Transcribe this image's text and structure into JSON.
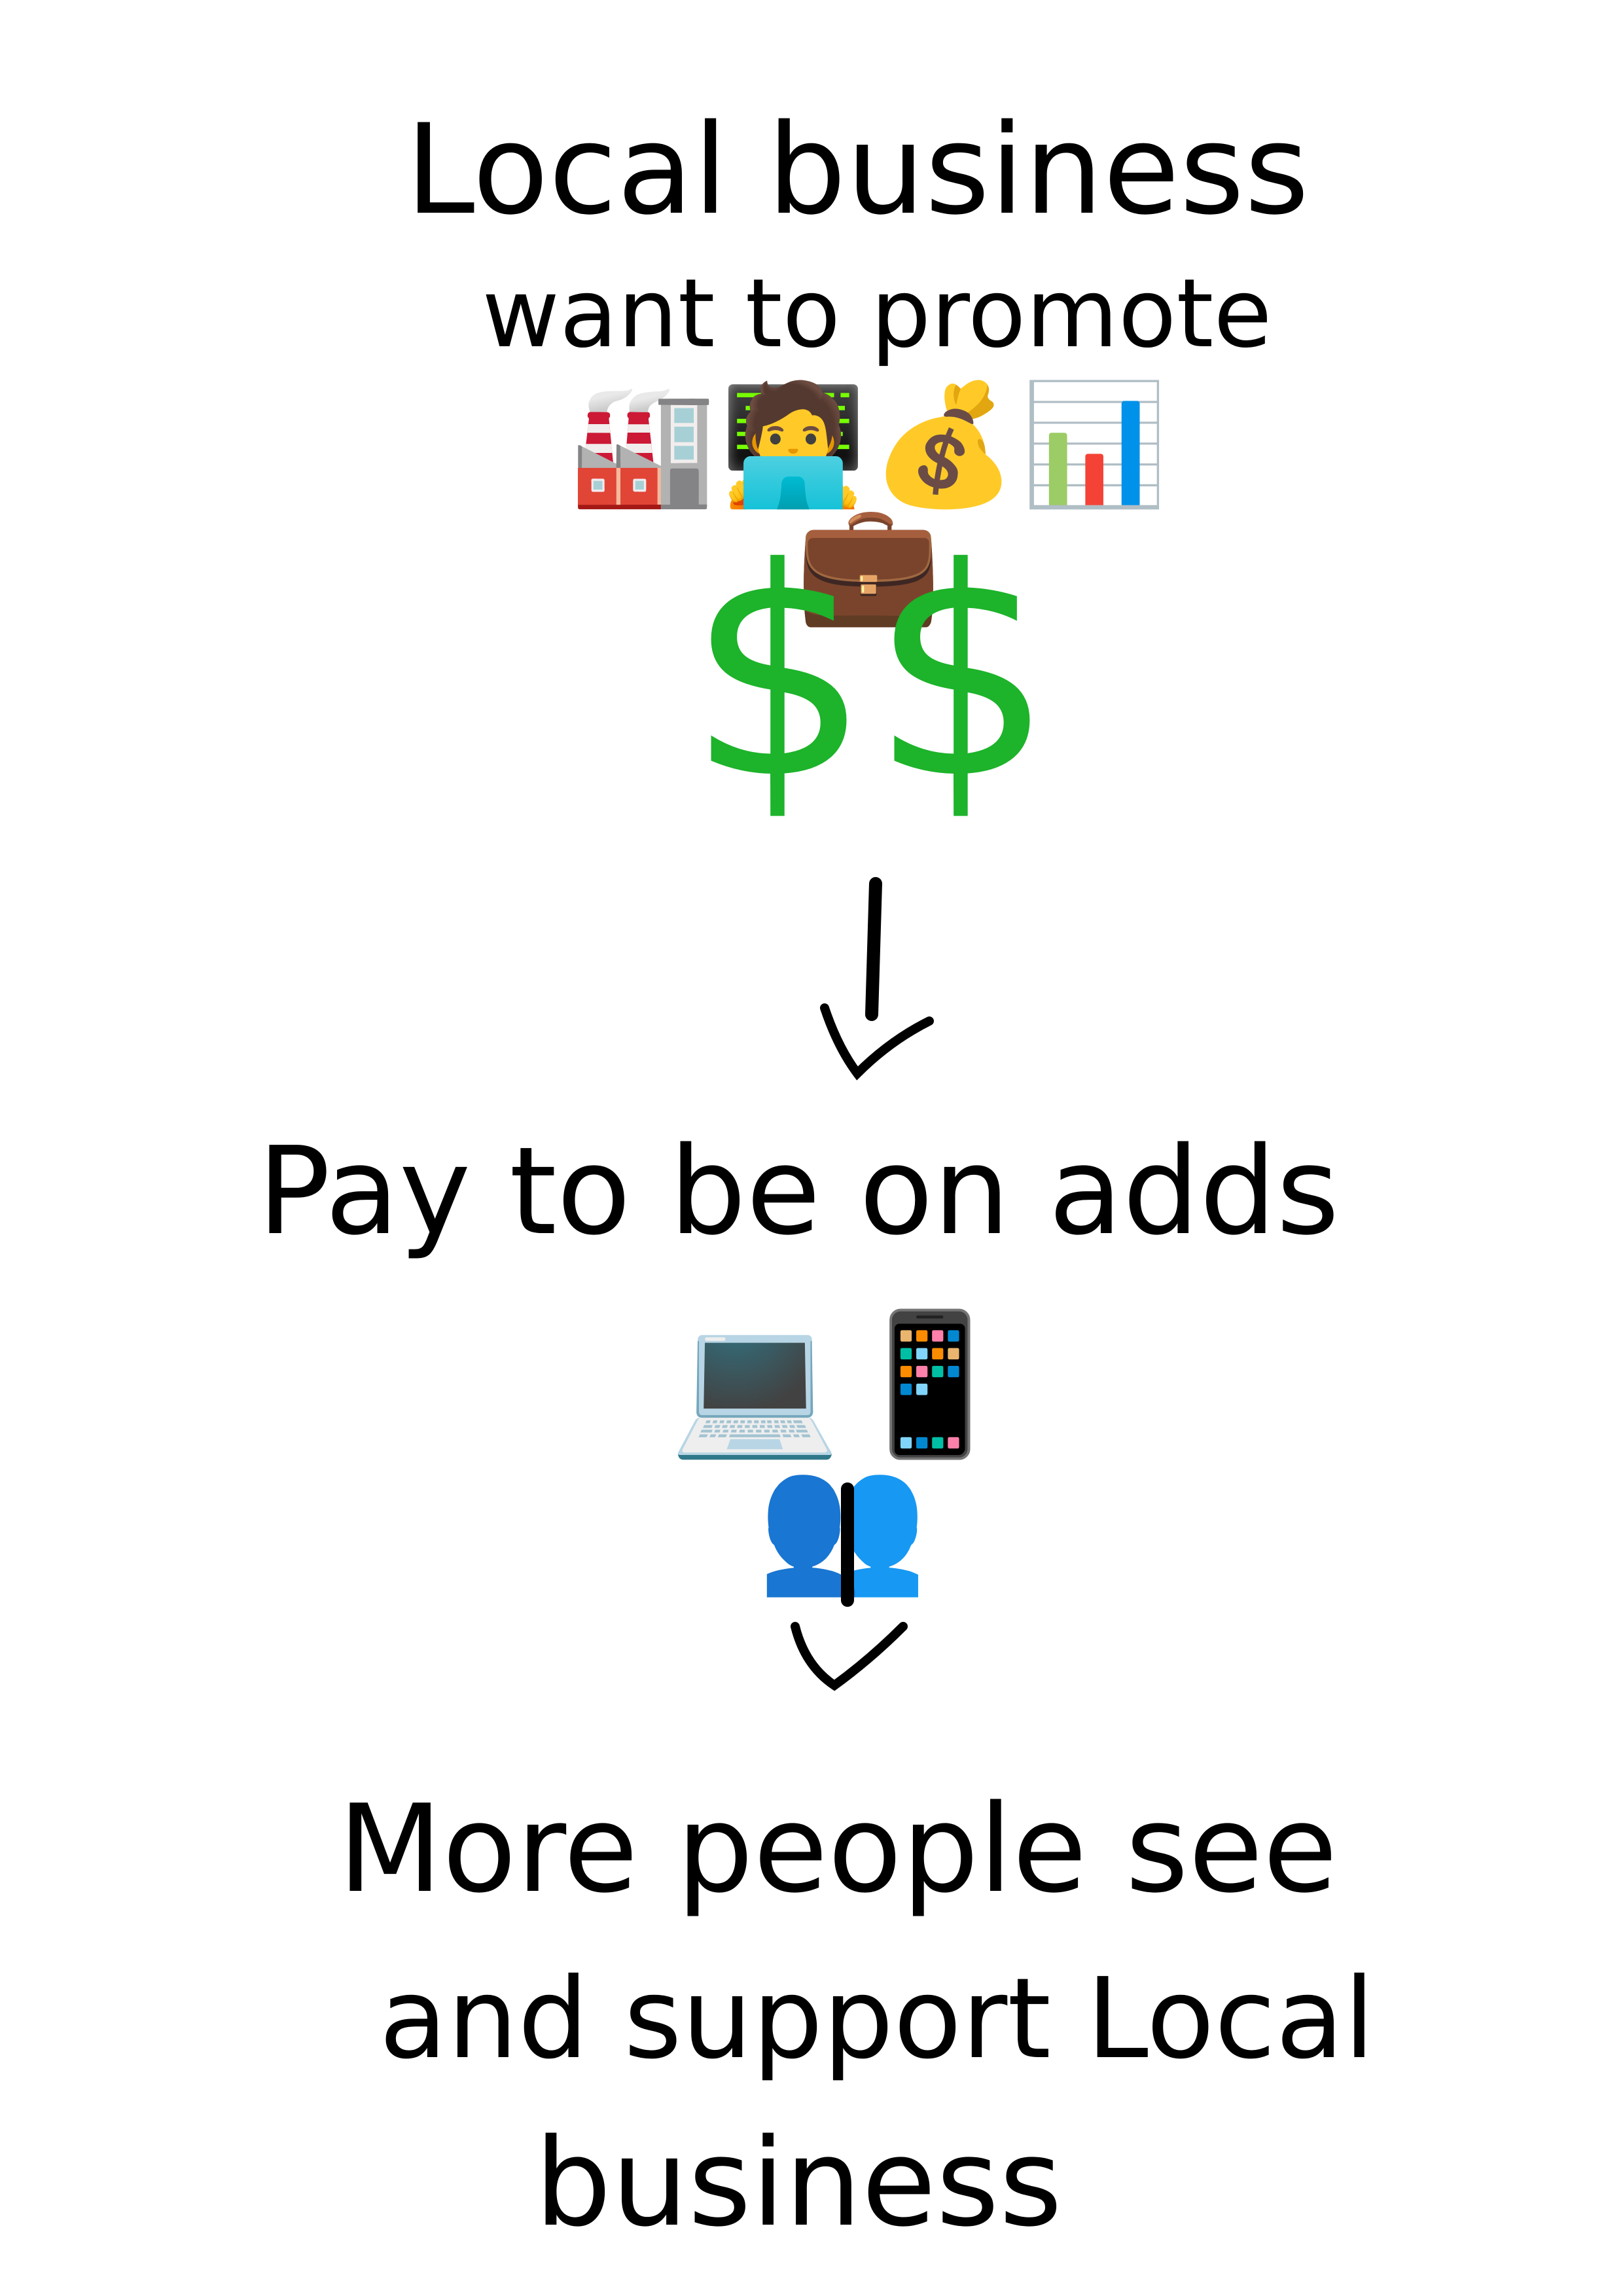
{
  "section1": {
    "line1": "Local business",
    "line2": "want to promote",
    "emojis": "🏭🧑‍💻💰📊💼",
    "emoji_names": [
      "factory",
      "technologist",
      "money-bag",
      "bar-chart",
      "briefcase"
    ],
    "money": "$$",
    "money_color": "#1db32a"
  },
  "section2": {
    "line1": "Pay to be on adds",
    "emojis": "💻📱👥",
    "emoji_names": [
      "laptop",
      "mobile-phone",
      "busts-in-silhouette"
    ]
  },
  "section3": {
    "line1": "More people see",
    "line2": "and support Local",
    "line3": "business"
  },
  "colors": {
    "ink": "#000000",
    "accent": "#1db32a"
  }
}
